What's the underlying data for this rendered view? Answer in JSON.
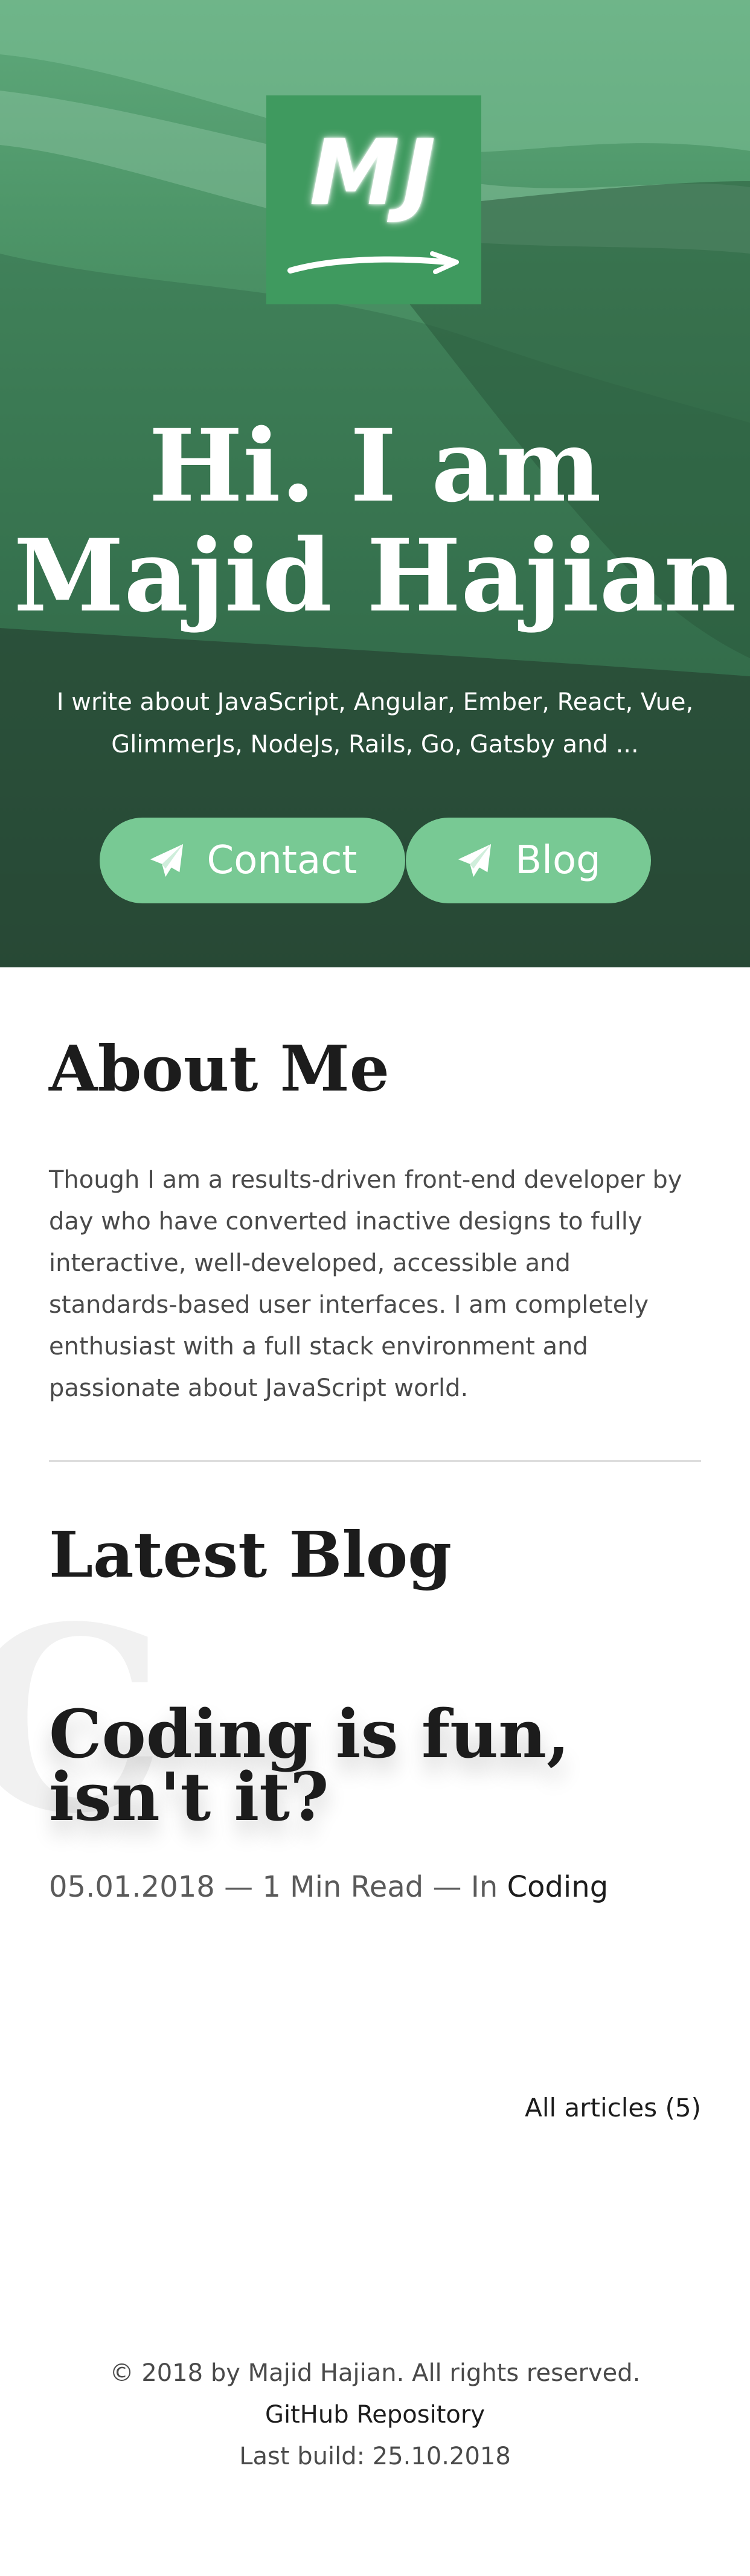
{
  "hero": {
    "logo_text": "MJ",
    "title_line1": "Hi. I am",
    "title_line2": "Majid Hajian",
    "subtitle": "I write about JavaScript, Angular, Ember, React, Vue, GlimmerJs, NodeJs, Rails, Go, Gatsby and ...",
    "buttons": [
      {
        "label": "Contact",
        "icon": "paper-plane-icon"
      },
      {
        "label": "Blog",
        "icon": "paper-plane-icon"
      }
    ]
  },
  "about": {
    "title": "About Me",
    "text": "Though I am a results-driven front-end developer by day who have converted inactive designs to fully interactive, well-developed, accessible and standards-based user interfaces. I am completely enthusiast with a full stack environment and passionate about JavaScript world."
  },
  "blog": {
    "title": "Latest Blog",
    "ghost_letter": "C",
    "posts": [
      {
        "title": "Coding is fun, isn't it?",
        "date": "05.01.2018",
        "separator": "—",
        "read_time": "1 Min Read",
        "category_prefix": "In",
        "category": "Coding"
      }
    ],
    "all_articles_label": "All articles (5)"
  },
  "footer": {
    "copyright": "© 2018 by Majid Hajian. All rights reserved.",
    "repo_link": "GitHub Repository",
    "last_build": "Last build: 25.10.2018"
  },
  "colors": {
    "accent": "#78c994",
    "hero_green": "#3f9a5f",
    "text_dark": "#1c1c1c",
    "text_muted": "#4a4a4a"
  }
}
